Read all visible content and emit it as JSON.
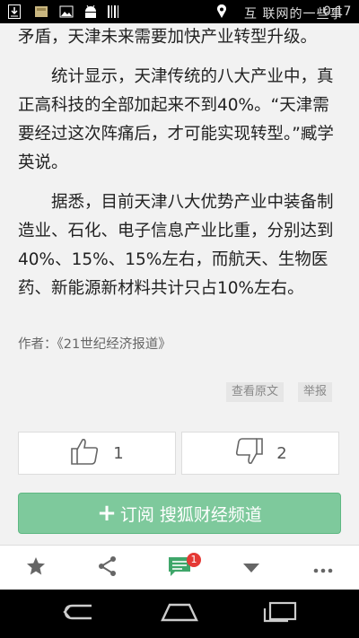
{
  "status_bar": {
    "right_text": "互 联网的一些事",
    "time": "0:17",
    "icons": [
      "download-icon",
      "image-icon",
      "gallery-icon",
      "android-icon",
      "barcode-icon",
      "location-icon",
      "wifi-icon",
      "signal-icon",
      "battery-icon"
    ]
  },
  "article": {
    "paragraphs": [
      "矛盾，天津未来需要加快产业转型升级。",
      "统计显示，天津传统的八大产业中，真正高科技的全部加起来不到40%。“天津需要经过这次阵痛后，才可能实现转型。”臧学英说。",
      "据悉，目前天津八大优势产业中装备制造业、石化、电子信息产业比重，分别达到40%、15%、15%左右，而航天、生物医药、新能源新材料共计只占10%左右。"
    ],
    "author": "作者：《21世纪经济报道》",
    "view_original": "查看原文",
    "report": "举报"
  },
  "votes": {
    "like_count": "1",
    "dislike_count": "2"
  },
  "subscribe": {
    "label": "订阅 搜狐财经频道"
  },
  "toolbar": {
    "comment_badge": "1",
    "icons": [
      "star-icon",
      "share-icon",
      "comment-icon",
      "chevron-down-icon",
      "more-icon"
    ]
  },
  "colors": {
    "accent_green": "#4caf78",
    "subscribe_bg": "#7ec99c",
    "badge_red": "#e53935"
  }
}
